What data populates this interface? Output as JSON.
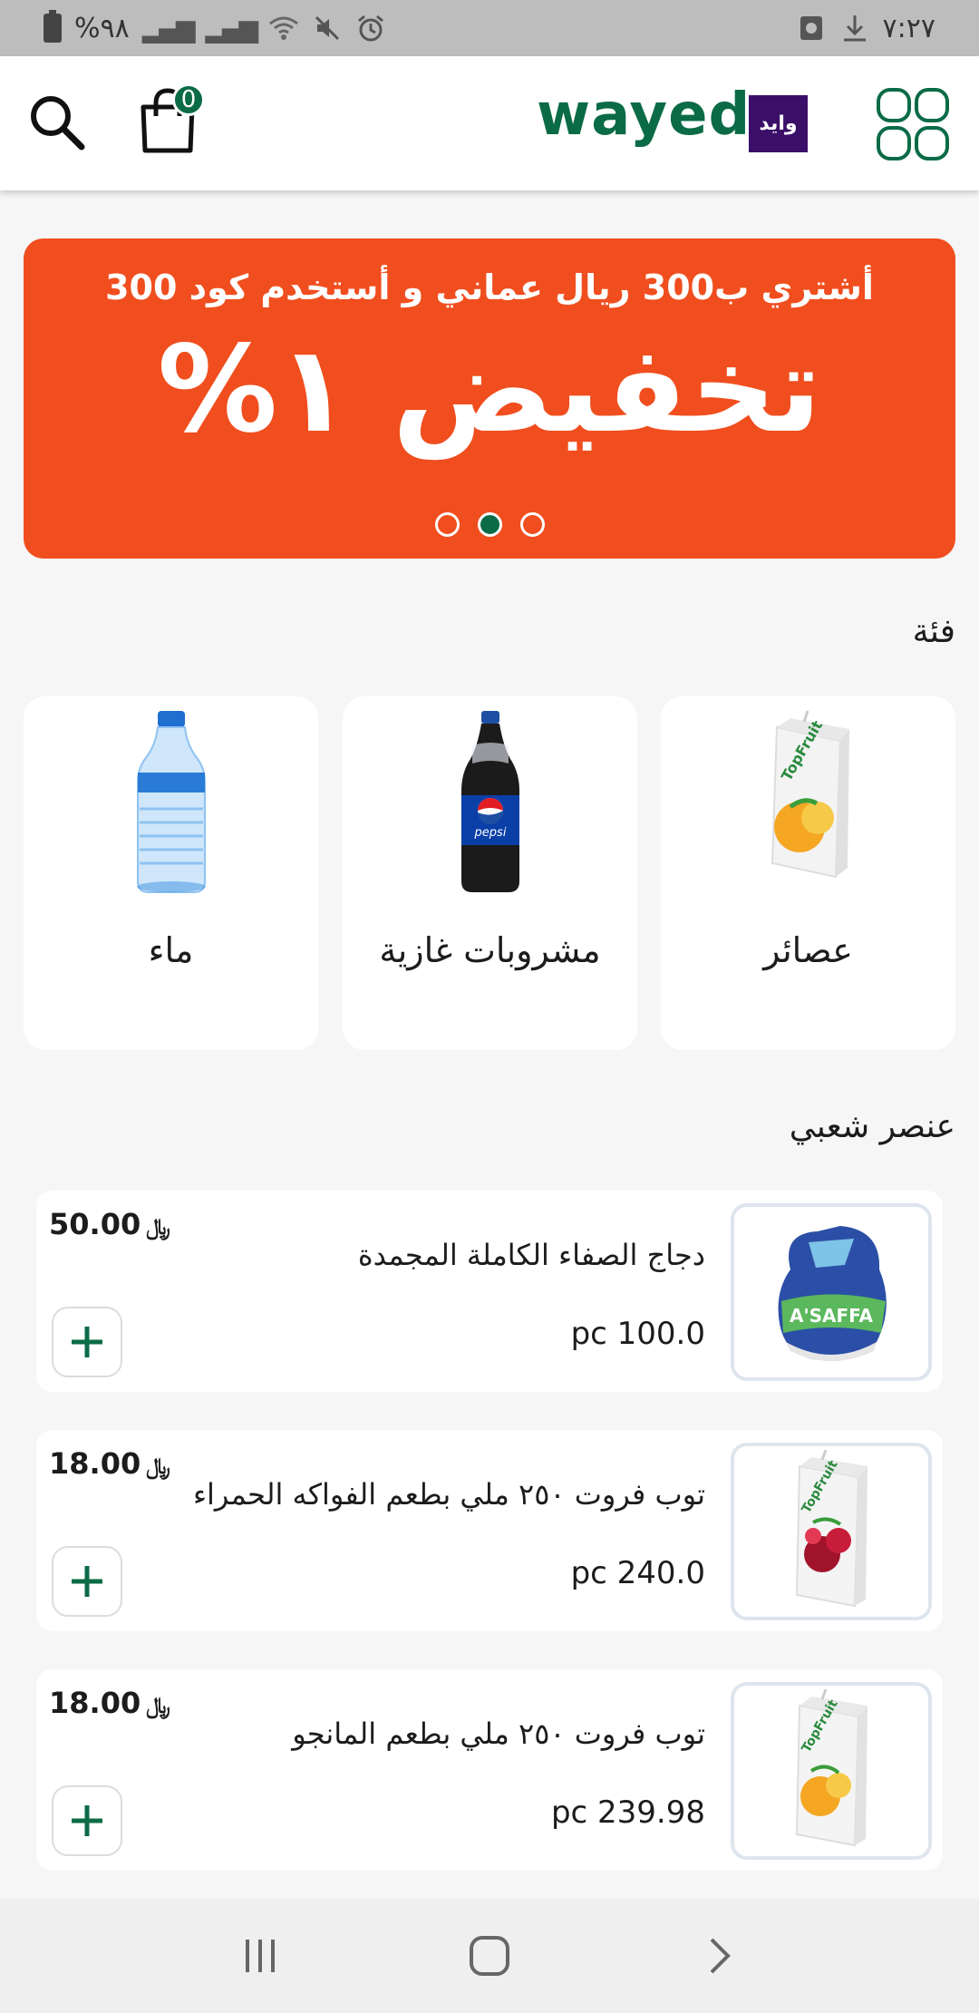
{
  "status_bar": {
    "battery_text": "%٩٨",
    "time": "٧:٢٧"
  },
  "header": {
    "cart_count": "0",
    "logo_text": "wayed",
    "logo_mark_text": "وايد"
  },
  "banner": {
    "subtitle": "أشتري ب300 ريال عماني و أستخدم كود 300",
    "title": "تخفيض ١%",
    "slides": 3,
    "active_slide": 2,
    "color": "#f04e1e"
  },
  "categories": {
    "title": "فئة",
    "items": [
      {
        "label": "عصائر",
        "icon": "mango-juice-box"
      },
      {
        "label": "مشروبات غازية",
        "icon": "pepsi-bottle"
      },
      {
        "label": "ماء",
        "icon": "water-bottle"
      }
    ]
  },
  "popular": {
    "title": "عنصر شعبي",
    "currency": "﷼",
    "items": [
      {
        "name": "دجاج الصفاء الكاملة المجمدة",
        "qty": "pc 100.0",
        "price": "50.00",
        "icon": "frozen-chicken"
      },
      {
        "name": "توب فروت ٢٥٠ ملي بطعم الفواكه الحمراء",
        "qty": "pc 240.0",
        "price": "18.00",
        "icon": "red-fruit-juice-box"
      },
      {
        "name": "توب فروت ٢٥٠ ملي بطعم المانجو",
        "qty": "pc 239.98",
        "price": "18.00",
        "icon": "mango-juice-box"
      }
    ]
  },
  "brand_color": "#0b6b47"
}
